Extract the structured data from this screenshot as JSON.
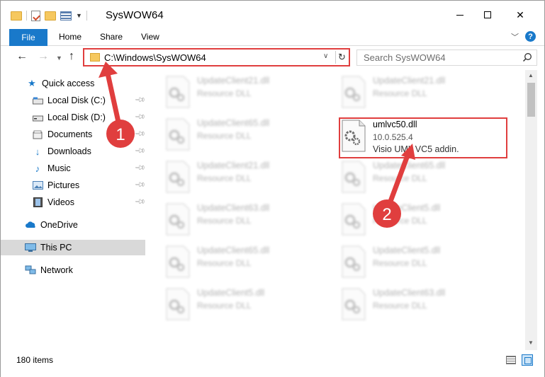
{
  "window": {
    "title": "SysWOW64"
  },
  "ribbon": {
    "tabs": [
      "File",
      "Home",
      "Share",
      "View"
    ],
    "help": "?"
  },
  "address": {
    "path": "C:\\Windows\\SysWOW64",
    "search_placeholder": "Search SysWOW64"
  },
  "nav": {
    "quick_access": "Quick access",
    "items": [
      {
        "label": "Local Disk (C:)",
        "icon": "drive-icon",
        "pinned": true
      },
      {
        "label": "Local Disk (D:)",
        "icon": "drive-icon",
        "pinned": true
      },
      {
        "label": "Documents",
        "icon": "documents-icon",
        "pinned": true
      },
      {
        "label": "Downloads",
        "icon": "downloads-icon",
        "pinned": true
      },
      {
        "label": "Music",
        "icon": "music-icon",
        "pinned": true
      },
      {
        "label": "Pictures",
        "icon": "pictures-icon",
        "pinned": true
      },
      {
        "label": "Videos",
        "icon": "videos-icon",
        "pinned": true
      }
    ],
    "onedrive": "OneDrive",
    "this_pc": "This PC",
    "network": "Network"
  },
  "files": [
    {
      "name": "UpdateClient21.dll",
      "type": "Resource DLL",
      "blurred": true
    },
    {
      "name": "UpdateClient21.dll",
      "type": "Resource DLL",
      "blurred": true
    },
    {
      "name": "UpdateClient65.dll",
      "type": "Resource DLL",
      "blurred": true
    },
    {
      "name": "umlvc50.dll",
      "version": "10.0.525.4",
      "description": "Visio UML VC5 addin.",
      "blurred": false
    },
    {
      "name": "UpdateClient21.dll",
      "type": "Resource DLL",
      "blurred": true
    },
    {
      "name": "UpdateClient65.dll",
      "type": "Resource DLL",
      "blurred": true
    },
    {
      "name": "UpdateClient63.dll",
      "type": "Resource DLL",
      "blurred": true
    },
    {
      "name": "UpdateClient5.dll",
      "type": "Resource DLL",
      "blurred": true
    },
    {
      "name": "UpdateClient65.dll",
      "type": "Resource DLL",
      "blurred": true
    },
    {
      "name": "UpdateClient5.dll",
      "type": "Resource DLL",
      "blurred": true
    },
    {
      "name": "UpdateClient5.dll",
      "type": "Resource DLL",
      "blurred": true
    },
    {
      "name": "UpdateClient63.dll",
      "type": "Resource DLL",
      "blurred": true
    }
  ],
  "status": {
    "count": "180 items"
  },
  "annotations": {
    "step1": "1",
    "step2": "2",
    "color": "#e03e3e"
  }
}
